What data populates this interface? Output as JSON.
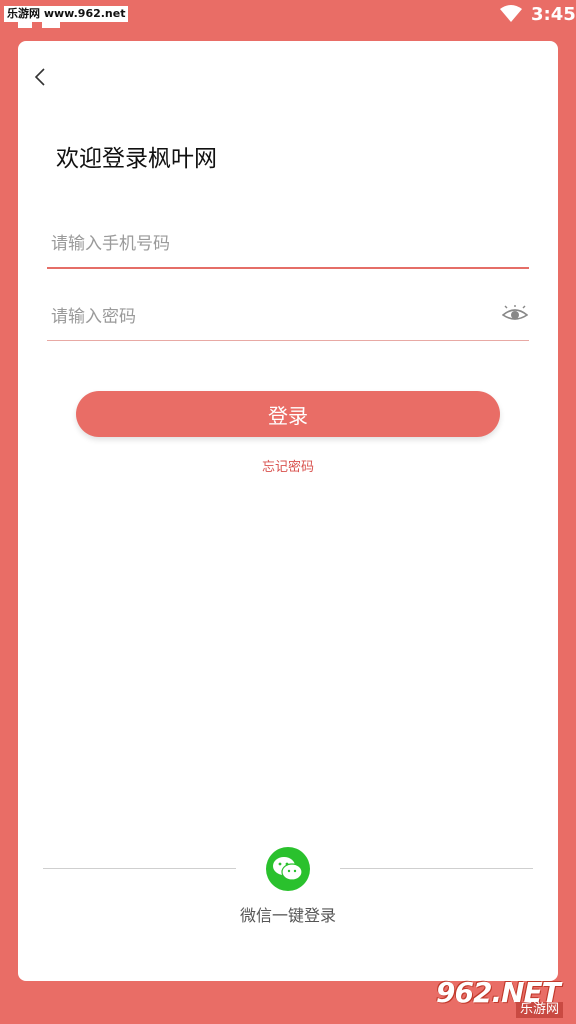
{
  "status_bar": {
    "watermark": "乐游网 www.962.net",
    "time": "3:45"
  },
  "login": {
    "title": "欢迎登录枫叶网",
    "phone_placeholder": "请输入手机号码",
    "password_placeholder": "请输入密码",
    "login_button": "登录",
    "forgot_password": "忘记密码",
    "wechat_login": "微信一键登录"
  },
  "watermark_bottom": {
    "brand": "962.NET",
    "name": "乐游网"
  },
  "colors": {
    "accent": "#E96D66",
    "wechat": "#2AC12D"
  }
}
